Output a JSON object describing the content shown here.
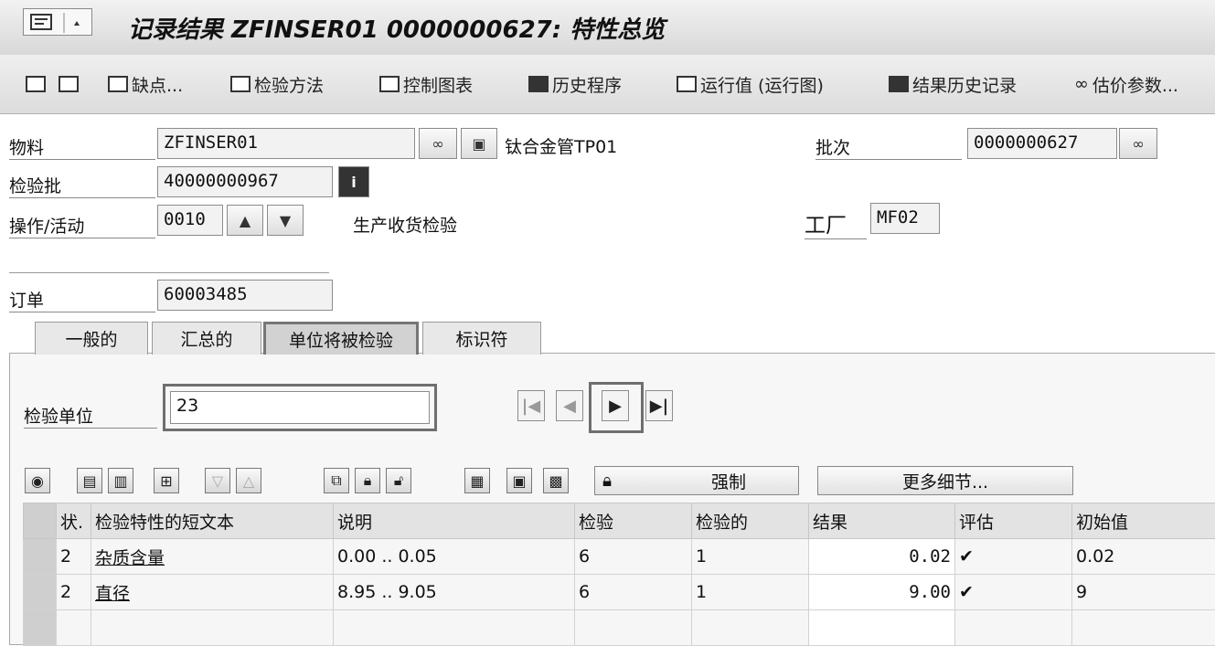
{
  "window": {
    "title": "记录结果 ZFINSER01 0000000627: 特性总览"
  },
  "toolbar": {
    "defects": "缺点...",
    "inspection_method": "检验方法",
    "control_chart": "控制图表",
    "history": "历史程序",
    "run_chart": "运行值 (运行图)",
    "result_history": "结果历史记录",
    "valuation_params": "估价参数..."
  },
  "header": {
    "material_label": "物料",
    "material_value": "ZFINSER01",
    "material_desc": "钛合金管TP01",
    "batch_label": "批次",
    "batch_value": "0000000627",
    "inspection_lot_label": "检验批",
    "inspection_lot_value": "40000000967",
    "operation_label": "操作/活动",
    "operation_value": "0010",
    "operation_desc": "生产收货检验",
    "plant_label": "工厂",
    "plant_value": "MF02",
    "order_label": "订单",
    "order_value": "60003485"
  },
  "tabs": [
    "一般的",
    "汇总的",
    "单位将被检验",
    "标识符"
  ],
  "unit": {
    "label": "检验单位",
    "value": "23"
  },
  "table_toolbar": {
    "force_label": "强制",
    "more_details_label": "更多细节..."
  },
  "table": {
    "columns": [
      "状.",
      "检验特性的短文本",
      "说明",
      "检验",
      "检验的",
      "结果",
      "评估",
      "初始值"
    ],
    "rows": [
      {
        "status": "2",
        "text": "杂质含量",
        "desc": "0.00 .. 0.05",
        "insp": "6",
        "inspected": "1",
        "result": "0.02",
        "eval": "✔",
        "initial": "0.02"
      },
      {
        "status": "2",
        "text": "直径",
        "desc": "8.95 .. 9.05",
        "insp": "6",
        "inspected": "1",
        "result": "9.00",
        "eval": "✔",
        "initial": "9"
      }
    ]
  }
}
